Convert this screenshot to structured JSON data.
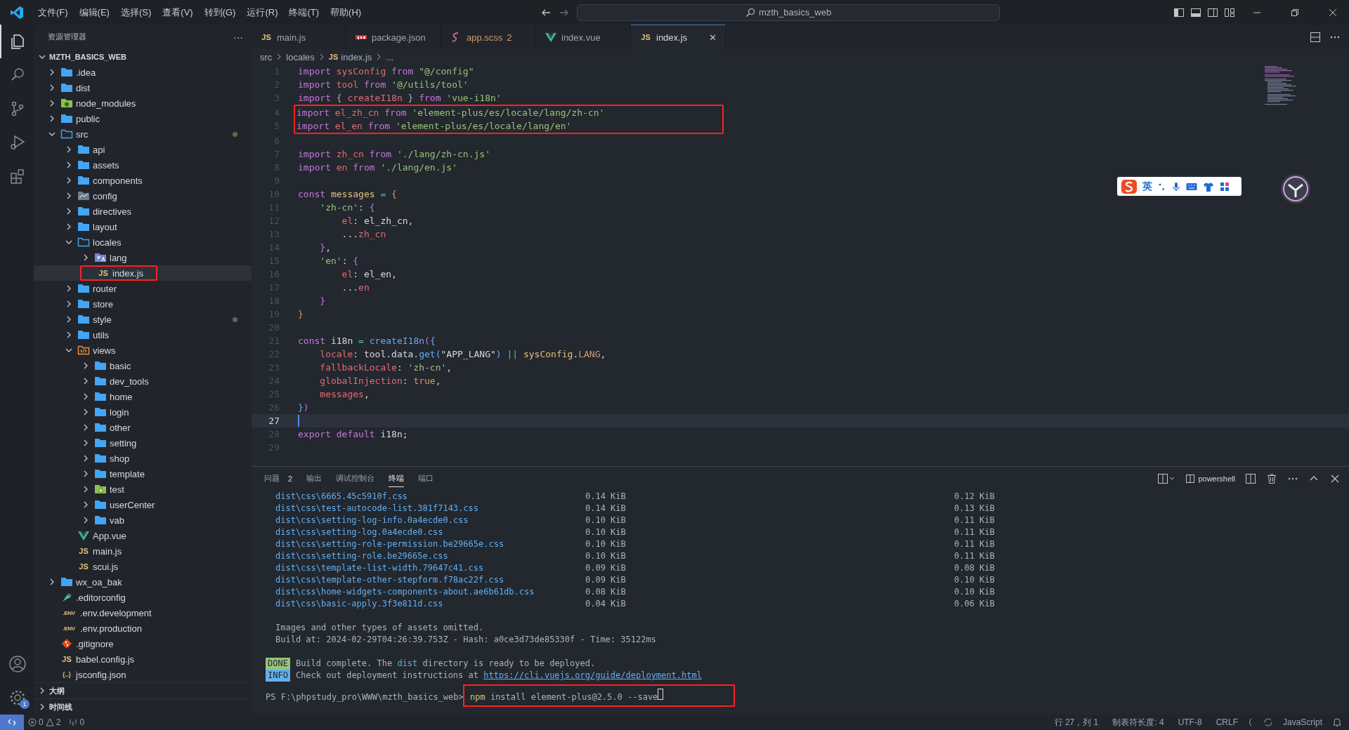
{
  "title_bar": {
    "menus": [
      "文件(F)",
      "编辑(E)",
      "选择(S)",
      "查看(V)",
      "转到(G)",
      "运行(R)",
      "终端(T)",
      "帮助(H)"
    ],
    "search": "mzth_basics_web"
  },
  "activity_bar": {
    "items": [
      {
        "kind": "files",
        "selected": true
      },
      {
        "kind": "search",
        "selected": false
      },
      {
        "kind": "source-control",
        "selected": false
      },
      {
        "kind": "run",
        "selected": false
      },
      {
        "kind": "extensions",
        "selected": false
      }
    ],
    "settings_badge": "1"
  },
  "sidebar": {
    "title": "资源管理器",
    "more": "···",
    "project": "MZTH_BASICS_WEB",
    "tree": [
      {
        "label": ".idea",
        "kind": "folder",
        "expanded": false,
        "selected": false
      },
      {
        "label": "dist",
        "kind": "folder",
        "expanded": false,
        "selected": false
      },
      {
        "label": "node_modules",
        "kind": "node",
        "expanded": false,
        "selected": false
      },
      {
        "label": "public",
        "kind": "folder",
        "expanded": false,
        "selected": false
      },
      {
        "label": "src",
        "kind": "folder",
        "expanded": true,
        "selected": false,
        "modified": true,
        "children": [
          {
            "label": "api",
            "kind": "folder",
            "expanded": false,
            "selected": false
          },
          {
            "label": "assets",
            "kind": "folder",
            "expanded": false,
            "selected": false
          },
          {
            "label": "components",
            "kind": "folder",
            "expanded": false,
            "selected": false
          },
          {
            "label": "config",
            "kind": "chart",
            "expanded": false,
            "selected": false
          },
          {
            "label": "directives",
            "kind": "folder",
            "expanded": false,
            "selected": false
          },
          {
            "label": "layout",
            "kind": "folder",
            "expanded": false,
            "selected": false
          },
          {
            "label": "locales",
            "kind": "folder",
            "expanded": true,
            "selected": false,
            "children": [
              {
                "label": "lang",
                "kind": "translate",
                "expanded": false,
                "selected": false
              },
              {
                "label": "index.js",
                "kind": "js",
                "icon_text": "JS",
                "selected": true,
                "highlighted": true
              }
            ]
          },
          {
            "label": "router",
            "kind": "folder",
            "expanded": false,
            "selected": false
          },
          {
            "label": "store",
            "kind": "folder",
            "expanded": false,
            "selected": false
          },
          {
            "label": "style",
            "kind": "folder",
            "expanded": false,
            "selected": false,
            "modified": true
          },
          {
            "label": "utils",
            "kind": "folder",
            "expanded": false,
            "selected": false
          },
          {
            "label": "views",
            "kind": "code-folder",
            "expanded": true,
            "selected": false,
            "children": [
              {
                "label": "basic",
                "kind": "folder",
                "expanded": false,
                "selected": false
              },
              {
                "label": "dev_tools",
                "kind": "folder",
                "expanded": false,
                "selected": false
              },
              {
                "label": "home",
                "kind": "folder",
                "expanded": false,
                "selected": false
              },
              {
                "label": "login",
                "kind": "folder",
                "expanded": false,
                "selected": false
              },
              {
                "label": "other",
                "kind": "folder",
                "expanded": false,
                "selected": false
              },
              {
                "label": "setting",
                "kind": "folder",
                "expanded": false,
                "selected": false
              },
              {
                "label": "shop",
                "kind": "folder",
                "expanded": false,
                "selected": false
              },
              {
                "label": "template",
                "kind": "folder",
                "expanded": false,
                "selected": false
              },
              {
                "label": "test",
                "kind": "test",
                "expanded": false,
                "selected": false
              },
              {
                "label": "userCenter",
                "kind": "folder",
                "expanded": false,
                "selected": false
              },
              {
                "label": "vab",
                "kind": "folder",
                "expanded": false,
                "selected": false
              }
            ]
          },
          {
            "label": "App.vue",
            "kind": "vue",
            "selected": false
          },
          {
            "label": "main.js",
            "kind": "js",
            "icon_text": "JS",
            "selected": false
          },
          {
            "label": "scui.js",
            "kind": "js",
            "icon_text": "JS",
            "selected": false
          }
        ]
      },
      {
        "label": "wx_oa_bak",
        "kind": "folder",
        "expanded": false,
        "selected": false
      },
      {
        "label": ".editorconfig",
        "kind": "editorconfig",
        "selected": false
      },
      {
        "label": ".env.development",
        "kind": "env",
        "icon_text": ".ENV",
        "selected": false
      },
      {
        "label": ".env.production",
        "kind": "env",
        "icon_text": ".ENV",
        "selected": false
      },
      {
        "label": ".gitignore",
        "kind": "git",
        "selected": false
      },
      {
        "label": "babel.config.js",
        "kind": "js",
        "icon_text": "JS",
        "selected": false
      },
      {
        "label": "jsconfig.json",
        "kind": "json",
        "icon_text": "{..}",
        "selected": false
      }
    ],
    "sections": [
      {
        "label": "大纲",
        "expanded": false
      },
      {
        "label": "时间线",
        "expanded": false
      }
    ]
  },
  "tabs": [
    {
      "label": "main.js",
      "kind": "js",
      "icon_text": "JS",
      "selected": false
    },
    {
      "label": "package.json",
      "kind": "npm",
      "selected": false
    },
    {
      "label": "app.scss",
      "kind": "sass",
      "problems": "2",
      "selected": false
    },
    {
      "label": "index.vue",
      "kind": "vue",
      "selected": false
    },
    {
      "label": "index.js",
      "kind": "js",
      "icon_text": "JS",
      "selected": true,
      "close": "✕"
    }
  ],
  "breadcrumb": [
    {
      "label": "src"
    },
    {
      "label": "locales"
    },
    {
      "label": "index.js",
      "icon_text": "JS"
    },
    {
      "label": "..."
    }
  ],
  "code": [
    {
      "number": "1",
      "tokens": [
        {
          "text": "import ",
          "kind": "kw"
        },
        {
          "text": "sysConfig",
          "kind": "var"
        },
        {
          "text": " from ",
          "kind": "kw"
        },
        {
          "text": "\"@/config\"",
          "kind": "str"
        }
      ]
    },
    {
      "number": "2",
      "tokens": [
        {
          "text": "import ",
          "kind": "kw"
        },
        {
          "text": "tool",
          "kind": "var"
        },
        {
          "text": " from ",
          "kind": "kw"
        },
        {
          "text": "'@/utils/tool'",
          "kind": "str"
        }
      ]
    },
    {
      "number": "3",
      "tokens": [
        {
          "text": "import ",
          "kind": "kw"
        },
        {
          "text": "{ ",
          "kind": "punct"
        },
        {
          "text": "createI18n",
          "kind": "var"
        },
        {
          "text": " } ",
          "kind": "punct"
        },
        {
          "text": "from ",
          "kind": "kw"
        },
        {
          "text": "'vue-i18n'",
          "kind": "str"
        }
      ]
    },
    {
      "number": "4",
      "highlighted": true,
      "tokens": [
        {
          "text": "import ",
          "kind": "kw"
        },
        {
          "text": "el_zh_cn",
          "kind": "var"
        },
        {
          "text": " from ",
          "kind": "kw"
        },
        {
          "text": "'element-plus/es/locale/lang/zh-cn'",
          "kind": "str"
        }
      ]
    },
    {
      "number": "5",
      "highlighted": true,
      "tokens": [
        {
          "text": "import ",
          "kind": "kw"
        },
        {
          "text": "el_en",
          "kind": "var"
        },
        {
          "text": " from ",
          "kind": "kw"
        },
        {
          "text": "'element-plus/es/locale/lang/en'",
          "kind": "str"
        }
      ]
    },
    {
      "number": "6"
    },
    {
      "number": "7",
      "tokens": [
        {
          "text": "import ",
          "kind": "kw"
        },
        {
          "text": "zh_cn",
          "kind": "var"
        },
        {
          "text": " from ",
          "kind": "kw"
        },
        {
          "text": "'./lang/zh-cn.js'",
          "kind": "str"
        }
      ]
    },
    {
      "number": "8",
      "tokens": [
        {
          "text": "import ",
          "kind": "kw"
        },
        {
          "text": "en",
          "kind": "var"
        },
        {
          "text": " from ",
          "kind": "kw"
        },
        {
          "text": "'./lang/en.js'",
          "kind": "str"
        }
      ]
    },
    {
      "number": "9"
    },
    {
      "number": "10",
      "tokens": [
        {
          "text": "const ",
          "kind": "kw"
        },
        {
          "text": "messages",
          "kind": "ident"
        },
        {
          "text": " = ",
          "kind": "op"
        },
        {
          "text": "{",
          "kind": "brace"
        }
      ]
    },
    {
      "number": "11",
      "tokens": [
        {
          "text": "    'zh-cn'",
          "kind": "str"
        },
        {
          "text": ": ",
          "kind": "plain"
        },
        {
          "text": "{",
          "kind": "brace2"
        }
      ]
    },
    {
      "number": "12",
      "tokens": [
        {
          "text": "        el",
          "kind": "var"
        },
        {
          "text": ": el_zh_cn,",
          "kind": "plain"
        }
      ]
    },
    {
      "number": "13",
      "tokens": [
        {
          "text": "        ...",
          "kind": "plain"
        },
        {
          "text": "zh_cn",
          "kind": "var"
        }
      ]
    },
    {
      "number": "14",
      "tokens": [
        {
          "text": "    }",
          "kind": "brace2"
        },
        {
          "text": ",",
          "kind": "plain"
        }
      ]
    },
    {
      "number": "15",
      "tokens": [
        {
          "text": "    'en'",
          "kind": "str"
        },
        {
          "text": ": ",
          "kind": "plain"
        },
        {
          "text": "{",
          "kind": "brace2"
        }
      ]
    },
    {
      "number": "16",
      "tokens": [
        {
          "text": "        el",
          "kind": "var"
        },
        {
          "text": ": el_en,",
          "kind": "plain"
        }
      ]
    },
    {
      "number": "17",
      "tokens": [
        {
          "text": "        ...",
          "kind": "plain"
        },
        {
          "text": "en",
          "kind": "var"
        }
      ]
    },
    {
      "number": "18",
      "tokens": [
        {
          "text": "    }",
          "kind": "brace2"
        }
      ]
    },
    {
      "number": "19",
      "tokens": [
        {
          "text": "}",
          "kind": "brace"
        }
      ]
    },
    {
      "number": "20"
    },
    {
      "number": "21",
      "tokens": [
        {
          "text": "const ",
          "kind": "kw"
        },
        {
          "text": "i18n",
          "kind": "plain"
        },
        {
          "text": " = ",
          "kind": "op"
        },
        {
          "text": "createI18n",
          "kind": "fn"
        },
        {
          "text": "(",
          "kind": "brace2"
        },
        {
          "text": "{",
          "kind": "brace3"
        }
      ]
    },
    {
      "number": "22",
      "tokens": [
        {
          "text": "    locale",
          "kind": "var"
        },
        {
          "text": ": tool.data.",
          "kind": "plain"
        },
        {
          "text": "get",
          "kind": "fn"
        },
        {
          "text": "(",
          "kind": "brace3"
        },
        {
          "text": "\"APP_LANG\"",
          "kind": "plain"
        },
        {
          "text": ")",
          "kind": "brace3"
        },
        {
          "text": " || ",
          "kind": "op"
        },
        {
          "text": "sysConfig",
          "kind": "ident"
        },
        {
          "text": ".",
          "kind": "plain"
        },
        {
          "text": "LANG",
          "kind": "num"
        },
        {
          "text": ",",
          "kind": "plain"
        }
      ]
    },
    {
      "number": "23",
      "tokens": [
        {
          "text": "    fallbackLocale",
          "kind": "var"
        },
        {
          "text": ": ",
          "kind": "plain"
        },
        {
          "text": "'zh-cn'",
          "kind": "str"
        },
        {
          "text": ",",
          "kind": "plain"
        }
      ]
    },
    {
      "number": "24",
      "tokens": [
        {
          "text": "    globalInjection",
          "kind": "var"
        },
        {
          "text": ": ",
          "kind": "plain"
        },
        {
          "text": "true",
          "kind": "num"
        },
        {
          "text": ",",
          "kind": "plain"
        }
      ]
    },
    {
      "number": "25",
      "tokens": [
        {
          "text": "    messages",
          "kind": "var"
        },
        {
          "text": ",",
          "kind": "plain"
        }
      ]
    },
    {
      "number": "26",
      "tokens": [
        {
          "text": "}",
          "kind": "brace3"
        },
        {
          "text": ")",
          "kind": "brace2"
        }
      ]
    },
    {
      "number": "27",
      "current": true
    },
    {
      "number": "28",
      "tokens": [
        {
          "text": "export default ",
          "kind": "kw"
        },
        {
          "text": "i18n",
          "kind": "plain"
        },
        {
          "text": ";",
          "kind": "plain"
        }
      ]
    },
    {
      "number": "29"
    }
  ],
  "ime_toolbar": {
    "mode": "英"
  },
  "panel": {
    "tabs": [
      {
        "label": "问题",
        "badge": "2",
        "selected": false
      },
      {
        "label": "输出",
        "selected": false
      },
      {
        "label": "调试控制台",
        "selected": false
      },
      {
        "label": "终端",
        "selected": true
      },
      {
        "label": "端口",
        "selected": false
      }
    ],
    "shell": "powershell",
    "file_rows": [
      {
        "file": "dist\\css\\6665.45c5910f.css",
        "size": "0.14 KiB",
        "gzip": "0.12 KiB"
      },
      {
        "file": "dist\\css\\test-autocode-list.381f7143.css",
        "size": "0.14 KiB",
        "gzip": "0.13 KiB"
      },
      {
        "file": "dist\\css\\setting-log-info.0a4ecde0.css",
        "size": "0.10 KiB",
        "gzip": "0.11 KiB"
      },
      {
        "file": "dist\\css\\setting-log.0a4ecde0.css",
        "size": "0.10 KiB",
        "gzip": "0.11 KiB"
      },
      {
        "file": "dist\\css\\setting-role-permission.be29665e.css",
        "size": "0.10 KiB",
        "gzip": "0.11 KiB"
      },
      {
        "file": "dist\\css\\setting-role.be29665e.css",
        "size": "0.10 KiB",
        "gzip": "0.11 KiB"
      },
      {
        "file": "dist\\css\\template-list-width.79647c41.css",
        "size": "0.09 KiB",
        "gzip": "0.08 KiB"
      },
      {
        "file": "dist\\css\\template-other-stepform.f78ac22f.css",
        "size": "0.09 KiB",
        "gzip": "0.10 KiB"
      },
      {
        "file": "dist\\css\\home-widgets-components-about.ae6b61db.css",
        "size": "0.08 KiB",
        "gzip": "0.10 KiB"
      },
      {
        "file": "dist\\css\\basic-apply.3f3e811d.css",
        "size": "0.04 KiB",
        "gzip": "0.06 KiB"
      }
    ],
    "notes": [
      "Images and other types of assets omitted.",
      "Build at: 2024-02-29T04:26:39.753Z - Hash: a0ce3d73de85330f - Time: 35122ms"
    ],
    "messages": [
      {
        "badge": "DONE",
        "kind": "done",
        "parts": [
          {
            "text": "Build complete. The ",
            "kind": "plain"
          },
          {
            "text": "dist",
            "kind": "accent"
          },
          {
            "text": " directory is ready to be deployed.",
            "kind": "plain"
          }
        ]
      },
      {
        "badge": "INFO",
        "kind": "info",
        "parts": [
          {
            "text": "Check out deployment instructions at ",
            "kind": "plain"
          },
          {
            "text": "https://cli.vuejs.org/guide/deployment.html",
            "kind": "link"
          }
        ]
      }
    ],
    "prompt": {
      "path": "PS F:\\phpstudy_pro\\WWW\\mzth_basics_web>",
      "command": "npm",
      "args": "install element-plus@2.5.0 --save",
      "highlighted": true
    }
  },
  "status_bar": {
    "errors": "0",
    "warnings": "2",
    "ports": "0",
    "right": [
      {
        "label": "行 27，列 1",
        "kind": "text"
      },
      {
        "label": "制表符长度: 4",
        "kind": "text"
      },
      {
        "label": "UTF-8",
        "kind": "text"
      },
      {
        "label": "CRLF",
        "kind": "text"
      },
      {
        "label": "JavaScript",
        "kind": "language"
      }
    ]
  }
}
